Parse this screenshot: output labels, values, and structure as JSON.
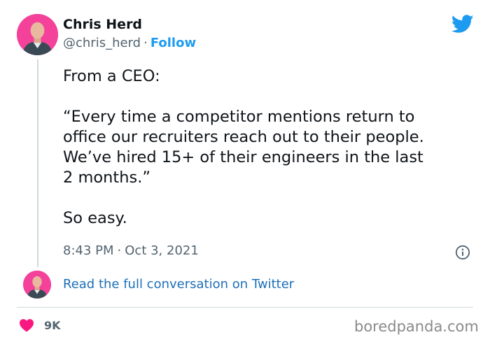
{
  "author": {
    "name": "Chris Herd",
    "handle": "@chris_herd",
    "separator": "·",
    "follow_label": "Follow"
  },
  "tweet": {
    "lines": [
      "From a CEO:",
      "",
      "“Every time a competitor mentions return to",
      "office our recruiters reach out to their people.",
      "We’ve hired 15+ of their engineers in the last",
      "2 months.”",
      "",
      "So easy."
    ],
    "time": "8:43 PM",
    "date": "Oct 3, 2021",
    "separator": "·"
  },
  "conversation_link": "Read the full conversation on Twitter",
  "likes": {
    "count": "9K"
  },
  "watermark": "boredpanda.com",
  "icons": {
    "twitter_logo": "twitter-bird-icon",
    "info": "info-icon",
    "heart": "heart-icon"
  },
  "colors": {
    "avatar_bg": "#f4429a",
    "twitter_blue": "#1d9bf0",
    "link_blue": "#1d6fb8",
    "heart_red": "#f91880",
    "secondary_text": "#536471"
  }
}
